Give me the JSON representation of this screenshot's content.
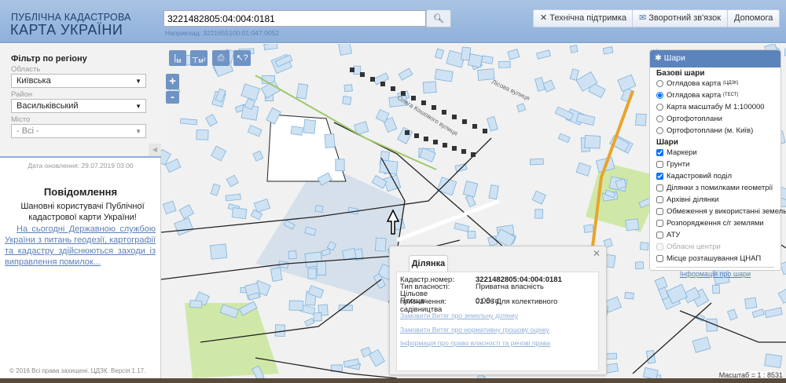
{
  "header": {
    "logo_line1": "ПУБЛІЧНА КАДАСТРОВА",
    "logo_line2": "КАРТА УКРАЇНИ",
    "search_value": "3221482805:04:004:0181",
    "search_hint": "Наприклад: 3221655100:01:047:0052",
    "buttons": {
      "support": "Технічна підтримка",
      "feedback": "Зворотний зв'язок",
      "help": "Допомога"
    }
  },
  "sidebar": {
    "filter_title": "Фільтр по регіону",
    "oblast_label": "Область",
    "oblast_value": "Київська",
    "raion_label": "Район",
    "raion_value": "Васильківський",
    "misto_label": "Місто",
    "misto_value": "- Всі -",
    "update_date": "Дата оновлення: 29.07.2019 03:00",
    "notice_title": "Повідомлення",
    "notice_text": "Шановні користувачі Публічної кадастрової карти України!",
    "notice_link": "На сьогодні Державною службою України з питань геодезії, картографії та кадастру здійснюються заходи із виправлення помилок...",
    "copyright": "© 2016 Всі права захищені. ЦДЗК. Версія 1.17."
  },
  "map": {
    "tools": {
      "measure_line": "м",
      "measure_area": "м²"
    },
    "zoom_in": "+",
    "zoom_out": "-",
    "scale": "Масштаб = 1 : 8531",
    "street1": "Олега Кошового вулиця",
    "street2": "Лісова вулиця"
  },
  "layers": {
    "title": "Шари",
    "base_title": "Базові шари",
    "base": [
      {
        "label": "Оглядова карта",
        "sup": "(ЦДЗК)",
        "checked": false
      },
      {
        "label": "Оглядова карта",
        "sup": "(ТЕСТ)",
        "checked": true
      },
      {
        "label": "Карта масштабу М 1:100000",
        "sup": "",
        "checked": false
      },
      {
        "label": "Ортофотоплани",
        "sup": "",
        "checked": false
      },
      {
        "label": "Ортофотоплани (м. Київ)",
        "sup": "",
        "checked": false
      }
    ],
    "layers_title": "Шари",
    "items": [
      {
        "label": "Маркери",
        "checked": true
      },
      {
        "label": "Грунти",
        "checked": false
      },
      {
        "label": "Кадастровий поділ",
        "checked": true
      },
      {
        "label": "Ділянки з помилками геометрії",
        "checked": false
      },
      {
        "label": "Архівні ділянки",
        "checked": false
      },
      {
        "label": "Обмеження у використанні земель",
        "checked": false
      },
      {
        "label": "Розпорядження с/г землями",
        "checked": false
      },
      {
        "label": "АТУ",
        "checked": false
      },
      {
        "label": "Обласні центри",
        "checked": false,
        "disabled": true
      },
      {
        "label": "Місце розташування ЦНАП",
        "checked": false
      }
    ],
    "info_link": "Інформація про шари"
  },
  "popup": {
    "tab": "Ділянка",
    "rows": [
      {
        "k": "Кадастр.номер:",
        "v": "3221482805:04:004:0181"
      },
      {
        "k": "Тип власності:",
        "v": "Приватна власність"
      },
      {
        "k": "Цільове призначення:",
        "v": "01.06 Для колективного садівництва"
      },
      {
        "k": "Площа:",
        "v": "0.06 га"
      }
    ],
    "links": [
      "Замовити Витяг про земельну ділянку",
      "Замовити Витяг про нормативну грошову оцінку",
      "Інформація про право власності та речові права"
    ]
  }
}
